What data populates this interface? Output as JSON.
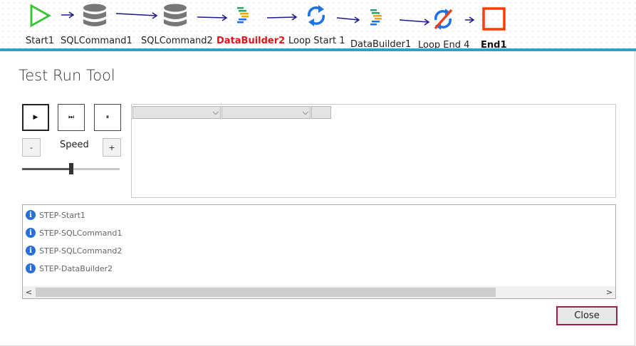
{
  "flow": {
    "nodes": [
      {
        "label": "Start1",
        "icon": "play-triangle-icon"
      },
      {
        "label": "SQLCommand1",
        "icon": "database-icon"
      },
      {
        "label": "SQLCommand2",
        "icon": "database-icon"
      },
      {
        "label": "DataBuilder2",
        "icon": "databuilder-icon",
        "state": "active"
      },
      {
        "label": "Loop Start 1",
        "icon": "loop-icon"
      },
      {
        "label": "DataBuilder1",
        "icon": "databuilder-icon"
      },
      {
        "label": "Loop End 4",
        "icon": "loop-end-icon"
      },
      {
        "label": "End1",
        "icon": "stop-square-icon"
      }
    ],
    "colors": {
      "start": "#3cc53c",
      "database": "#777777",
      "loop": "#1a73e8",
      "loop_end_slash": "#e8431a",
      "end": "#ff3d00",
      "active_label": "#e0141a",
      "arrow": "#1a1a8c",
      "divider": "#2aa3c9"
    }
  },
  "dialog": {
    "title": "Test Run Tool",
    "controls": {
      "play_glyph": "▶",
      "skip_glyph": "⏭",
      "pause_glyph": "⏸",
      "minus_label": "-",
      "plus_label": "+",
      "speed_label": "Speed",
      "speed_level": 0.5
    },
    "log": {
      "entries": [
        "STEP-Start1",
        "STEP-SQLCommand1",
        "STEP-SQLCommand2",
        "STEP-DataBuilder2"
      ],
      "info_glyph": "i",
      "scroll_left_glyph": "<",
      "scroll_right_glyph": ">"
    },
    "close_label": "Close",
    "colors": {
      "info": "#2a6fd6",
      "close_border": "#a01a4a"
    }
  }
}
